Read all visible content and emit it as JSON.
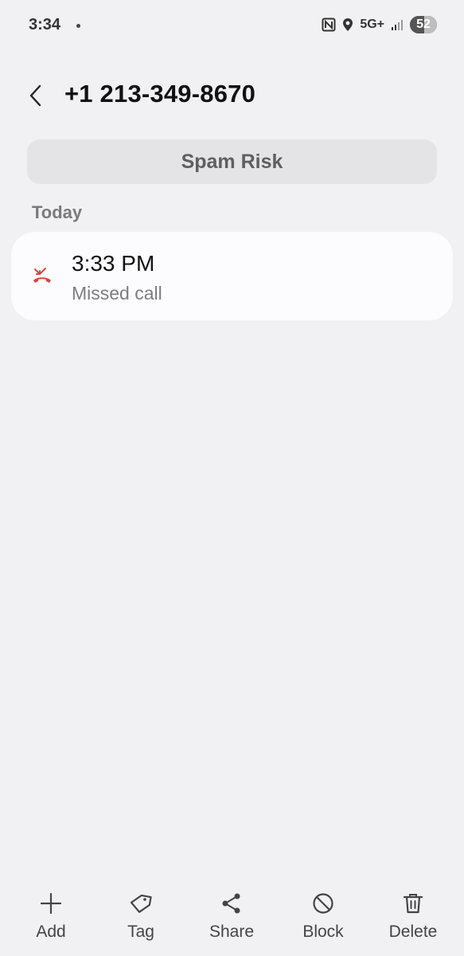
{
  "status_bar": {
    "time": "3:34",
    "network": "5G+",
    "battery": "52",
    "battery_level": 0.52
  },
  "header": {
    "title": "+1 213-349-8670"
  },
  "spam_label": "Spam Risk",
  "section_label": "Today",
  "calls": [
    {
      "time": "3:33 PM",
      "type": "Missed call",
      "icon": "missed-call-icon"
    }
  ],
  "actions": [
    {
      "label": "Add",
      "icon": "plus-icon"
    },
    {
      "label": "Tag",
      "icon": "tag-icon"
    },
    {
      "label": "Share",
      "icon": "share-icon"
    },
    {
      "label": "Block",
      "icon": "block-icon"
    },
    {
      "label": "Delete",
      "icon": "trash-icon"
    }
  ],
  "colors": {
    "background": "#f1f1f3",
    "missed_call": "#d14a3c",
    "spam_pill": "#e4e4e6"
  }
}
